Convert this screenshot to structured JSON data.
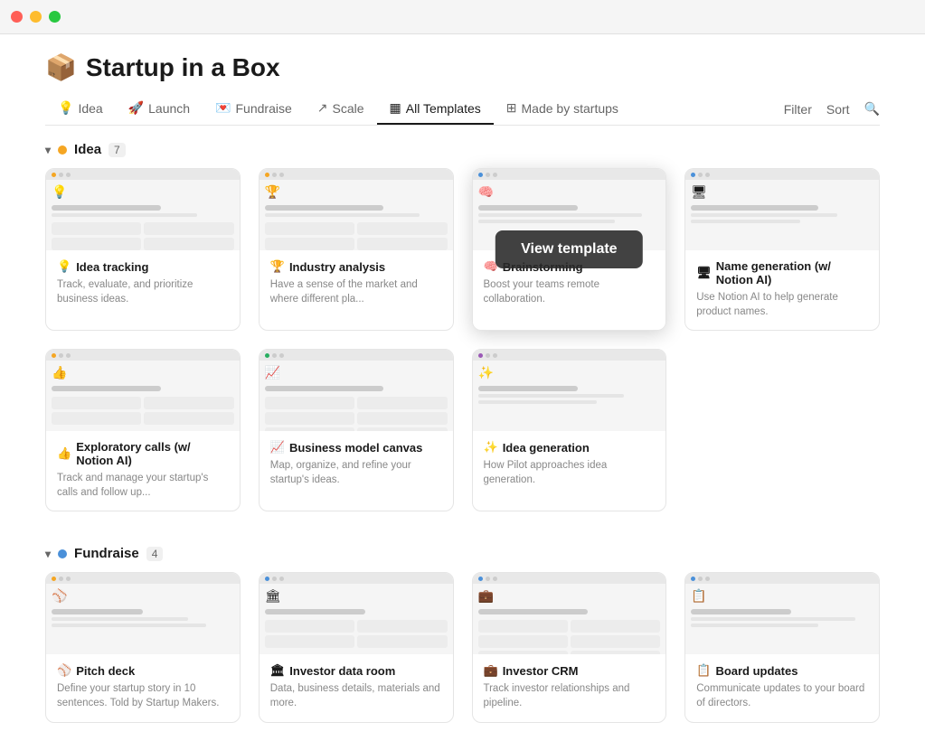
{
  "titlebar": {
    "lights": [
      "red",
      "yellow",
      "green"
    ]
  },
  "app": {
    "icon": "📦",
    "title": "Startup in a Box"
  },
  "nav": {
    "tabs": [
      {
        "id": "idea",
        "icon": "💡",
        "label": "Idea",
        "active": false
      },
      {
        "id": "launch",
        "icon": "🚀",
        "label": "Launch",
        "active": false
      },
      {
        "id": "fundraise",
        "icon": "💌",
        "label": "Fundraise",
        "active": false
      },
      {
        "id": "scale",
        "icon": "↗",
        "label": "Scale",
        "active": false
      },
      {
        "id": "all-templates",
        "icon": "▦",
        "label": "All Templates",
        "active": true
      },
      {
        "id": "made-by-startups",
        "icon": "⊞",
        "label": "Made by startups",
        "active": false
      }
    ],
    "actions": [
      {
        "id": "filter",
        "label": "Filter"
      },
      {
        "id": "sort",
        "label": "Sort"
      },
      {
        "id": "search",
        "label": "🔍"
      }
    ]
  },
  "sections": [
    {
      "id": "idea",
      "label": "Idea",
      "count": "7",
      "color": "#f5a623",
      "templates": [
        {
          "id": "idea-tracking",
          "icon": "💡",
          "title": "Idea tracking",
          "description": "Track, evaluate, and prioritize business ideas."
        },
        {
          "id": "industry-analysis",
          "icon": "🏆",
          "title": "Industry analysis",
          "description": "Have a sense of the market and where different pla..."
        },
        {
          "id": "brainstorming",
          "icon": "🧠",
          "title": "Brainstorming",
          "description": "Boost your teams remote collaboration.",
          "hovered": true
        },
        {
          "id": "name-generation",
          "icon": "🖥",
          "title": "Name generation (w/ Notion AI)",
          "description": "Use Notion AI to help generate product names."
        },
        {
          "id": "exploratory-calls",
          "icon": "👍",
          "title": "Exploratory calls (w/ Notion AI)",
          "description": "Track and manage your startup's calls and follow up..."
        },
        {
          "id": "business-model-canvas",
          "icon": "📈",
          "title": "Business model canvas",
          "description": "Map, organize, and refine your startup's ideas."
        },
        {
          "id": "idea-generation",
          "icon": "✨",
          "title": "Idea generation",
          "description": "How Pilot approaches idea generation."
        }
      ]
    },
    {
      "id": "fundraise",
      "label": "Fundraise",
      "count": "4",
      "color": "#4a90d9",
      "templates": [
        {
          "id": "pitch-deck",
          "icon": "⚾",
          "title": "Pitch deck",
          "description": "Define your startup story in 10 sentences. Told by Startup Makers."
        },
        {
          "id": "investor-data-room",
          "icon": "🏛",
          "title": "Investor data room",
          "description": "Data, business details, materials and more."
        },
        {
          "id": "investor-crm",
          "icon": "💼",
          "title": "Investor CRM",
          "description": "Track investor relationships and pipeline."
        },
        {
          "id": "board-updates",
          "icon": "📋",
          "title": "Board updates",
          "description": "Communicate updates to your board of directors."
        }
      ]
    }
  ],
  "view_template_label": "View template",
  "filter_label": "Filter",
  "sort_label": "Sort"
}
